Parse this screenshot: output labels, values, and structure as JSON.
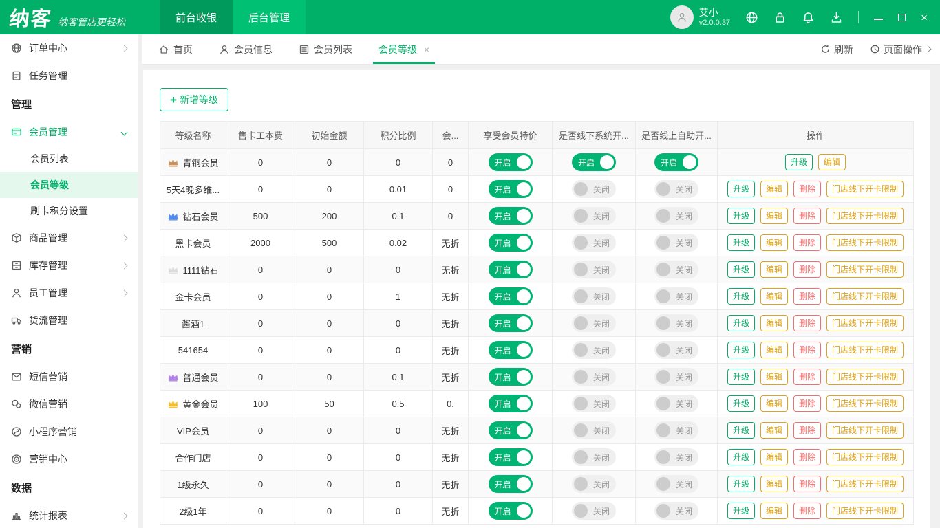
{
  "topbar": {
    "logo_text": "纳客",
    "slogan": "纳客管店更轻松",
    "nav_front": "前台收银",
    "nav_back": "后台管理",
    "user_name": "艾小",
    "version": "v2.0.0.37"
  },
  "sidebar": {
    "items": [
      {
        "label": "订单中心",
        "type": "item",
        "icon": "globe",
        "arrow": true
      },
      {
        "label": "任务管理",
        "type": "item",
        "icon": "tasks"
      },
      {
        "label": "管理",
        "type": "section"
      },
      {
        "label": "会员管理",
        "type": "item",
        "icon": "member",
        "expanded": true,
        "active": true
      },
      {
        "label": "会员列表",
        "type": "subitem"
      },
      {
        "label": "会员等级",
        "type": "subitem",
        "selected": true
      },
      {
        "label": "刷卡积分设置",
        "type": "subitem"
      },
      {
        "label": "商品管理",
        "type": "item",
        "icon": "goods",
        "arrow": true
      },
      {
        "label": "库存管理",
        "type": "item",
        "icon": "inventory",
        "arrow": true
      },
      {
        "label": "员工管理",
        "type": "item",
        "icon": "staff",
        "arrow": true
      },
      {
        "label": "货流管理",
        "type": "item",
        "icon": "truck"
      },
      {
        "label": "营销",
        "type": "section"
      },
      {
        "label": "短信营销",
        "type": "item",
        "icon": "sms"
      },
      {
        "label": "微信营销",
        "type": "item",
        "icon": "wechat"
      },
      {
        "label": "小程序营销",
        "type": "item",
        "icon": "miniprogram"
      },
      {
        "label": "营销中心",
        "type": "item",
        "icon": "target"
      },
      {
        "label": "数据",
        "type": "section"
      },
      {
        "label": "统计报表",
        "type": "item",
        "icon": "chart",
        "arrow": true
      }
    ]
  },
  "tabbar": {
    "tabs": [
      {
        "label": "首页",
        "icon": "home"
      },
      {
        "label": "会员信息",
        "icon": "user"
      },
      {
        "label": "会员列表",
        "icon": "list"
      },
      {
        "label": "会员等级",
        "active": true,
        "closable": true
      }
    ],
    "refresh": "刷新",
    "page_ops": "页面操作"
  },
  "main": {
    "add_button": "新增等级",
    "table": {
      "headers": [
        "等级名称",
        "售卡工本费",
        "初始金额",
        "积分比例",
        "会...",
        "享受会员特价",
        "是否线下系统开...",
        "是否线上自助开...",
        "操作"
      ],
      "toggle_on": "开启",
      "toggle_off": "关闭",
      "action_labels": {
        "upgrade": "升级",
        "edit": "编辑",
        "delete": "删除",
        "limit": "门店线下开卡限制"
      },
      "rows": [
        {
          "name": "青铜会员",
          "crown": "bronze",
          "fee": "0",
          "initial": "0",
          "ratio": "0",
          "discount": "0",
          "special": true,
          "offline": true,
          "online": true,
          "actions": [
            "upgrade",
            "edit"
          ]
        },
        {
          "name": "5天4晚多维...",
          "crown": null,
          "fee": "0",
          "initial": "0",
          "ratio": "0.01",
          "discount": "0",
          "special": true,
          "offline": false,
          "online": false,
          "actions": [
            "upgrade",
            "edit",
            "delete",
            "limit"
          ]
        },
        {
          "name": "钻石会员",
          "crown": "blue",
          "fee": "500",
          "initial": "200",
          "ratio": "0.1",
          "discount": "0",
          "special": true,
          "offline": false,
          "online": false,
          "actions": [
            "upgrade",
            "edit",
            "delete",
            "limit"
          ]
        },
        {
          "name": "黑卡会员",
          "crown": null,
          "fee": "2000",
          "initial": "500",
          "ratio": "0.02",
          "discount": "无折",
          "special": true,
          "offline": false,
          "online": false,
          "actions": [
            "upgrade",
            "edit",
            "delete",
            "limit"
          ]
        },
        {
          "name": "1111钻石",
          "crown": "silver",
          "fee": "0",
          "initial": "0",
          "ratio": "0",
          "discount": "无折",
          "special": true,
          "offline": false,
          "online": false,
          "actions": [
            "upgrade",
            "edit",
            "delete",
            "limit"
          ]
        },
        {
          "name": "金卡会员",
          "crown": null,
          "fee": "0",
          "initial": "0",
          "ratio": "1",
          "discount": "无折",
          "special": true,
          "offline": false,
          "online": false,
          "actions": [
            "upgrade",
            "edit",
            "delete",
            "limit"
          ]
        },
        {
          "name": "酱酒1",
          "crown": null,
          "fee": "0",
          "initial": "0",
          "ratio": "0",
          "discount": "无折",
          "special": true,
          "offline": false,
          "online": false,
          "actions": [
            "upgrade",
            "edit",
            "delete",
            "limit"
          ]
        },
        {
          "name": "541654",
          "crown": null,
          "fee": "0",
          "initial": "0",
          "ratio": "0",
          "discount": "无折",
          "special": true,
          "offline": false,
          "online": false,
          "actions": [
            "upgrade",
            "edit",
            "delete",
            "limit"
          ]
        },
        {
          "name": "普通会员",
          "crown": "purple",
          "fee": "0",
          "initial": "0",
          "ratio": "0.1",
          "discount": "无折",
          "special": true,
          "offline": false,
          "online": false,
          "actions": [
            "upgrade",
            "edit",
            "delete",
            "limit"
          ]
        },
        {
          "name": "黄金会员",
          "crown": "gold",
          "fee": "100",
          "initial": "50",
          "ratio": "0.5",
          "discount": "0.",
          "special": true,
          "offline": false,
          "online": false,
          "actions": [
            "upgrade",
            "edit",
            "delete",
            "limit"
          ]
        },
        {
          "name": "VIP会员",
          "crown": null,
          "fee": "0",
          "initial": "0",
          "ratio": "0",
          "discount": "无折",
          "special": true,
          "offline": false,
          "online": false,
          "actions": [
            "upgrade",
            "edit",
            "delete",
            "limit"
          ]
        },
        {
          "name": "合作门店",
          "crown": null,
          "fee": "0",
          "initial": "0",
          "ratio": "0",
          "discount": "无折",
          "special": true,
          "offline": false,
          "online": false,
          "actions": [
            "upgrade",
            "edit",
            "delete",
            "limit"
          ]
        },
        {
          "name": "1级永久",
          "crown": null,
          "fee": "0",
          "initial": "0",
          "ratio": "0",
          "discount": "无折",
          "special": true,
          "offline": false,
          "online": false,
          "actions": [
            "upgrade",
            "edit",
            "delete",
            "limit"
          ]
        },
        {
          "name": "2级1年",
          "crown": null,
          "fee": "0",
          "initial": "0",
          "ratio": "0",
          "discount": "无折",
          "special": true,
          "offline": false,
          "online": false,
          "actions": [
            "upgrade",
            "edit",
            "delete",
            "limit"
          ]
        }
      ]
    }
  }
}
